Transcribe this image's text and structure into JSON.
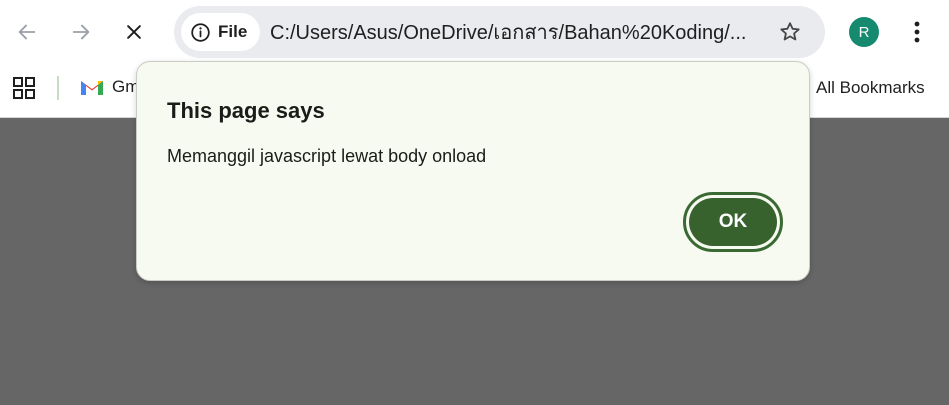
{
  "toolbar": {
    "back_icon": "arrow-left-icon",
    "forward_icon": "arrow-right-icon",
    "stop_icon": "close-icon",
    "site_info_label": "File",
    "url": "C:/Users/Asus/OneDrive/เอกสาร/Bahan%20Koding/...",
    "bookmark_icon": "star-icon",
    "profile_initial": "R",
    "menu_icon": "kebab-menu-icon"
  },
  "bookmarks": {
    "apps_icon": "apps-grid-icon",
    "gmail_label": "Gmail",
    "all_bookmarks_label": "All Bookmarks"
  },
  "dialog": {
    "title": "This page says",
    "message": "Memanggil javascript lewat body onload",
    "ok_label": "OK"
  },
  "colors": {
    "page_background": "#666666",
    "dialog_background": "#f7faf0",
    "ok_button": "#37622e",
    "avatar": "#168a6f"
  }
}
